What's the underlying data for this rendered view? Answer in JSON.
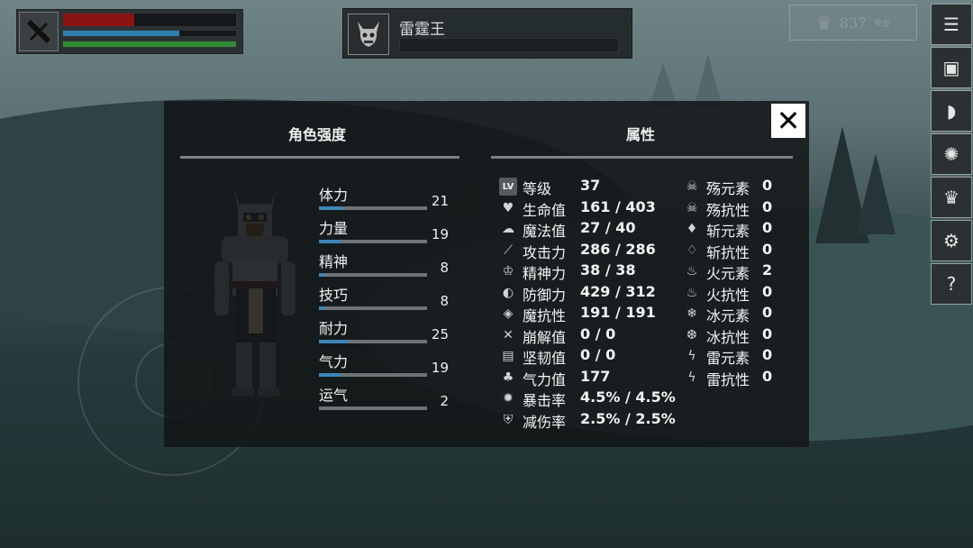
{
  "player": {
    "icon": "sword-icon",
    "health_fraction": 0.41,
    "mana_fraction": 0.67,
    "stamina_fraction": 1.0,
    "colors": {
      "health": "#8a1414",
      "mana": "#2f7fb0",
      "stamina": "#2f8a34"
    }
  },
  "boss": {
    "icon": "demon-skull-icon",
    "name": "雷霆王"
  },
  "honor": {
    "icon": "crown-icon",
    "value": "837",
    "unit": "荣誉"
  },
  "menu": [
    {
      "name": "list-menu-icon",
      "glyph": "☰"
    },
    {
      "name": "backpack-icon",
      "glyph": "▣"
    },
    {
      "name": "helmet-icon",
      "glyph": "◗"
    },
    {
      "name": "skill-medal-icon",
      "glyph": "✺"
    },
    {
      "name": "crown-menu-icon",
      "glyph": "♛"
    },
    {
      "name": "settings-gear-icon",
      "glyph": "⚙"
    },
    {
      "name": "help-question-icon",
      "glyph": "?"
    }
  ],
  "panel": {
    "left_title": "角色强度",
    "right_title": "属性",
    "close_label": "✕"
  },
  "stats": [
    {
      "label": "体力",
      "value": "21",
      "fill": 0.22
    },
    {
      "label": "力量",
      "value": "19",
      "fill": 0.2
    },
    {
      "label": "精神",
      "value": "8",
      "fill": 0.06
    },
    {
      "label": "技巧",
      "value": "8",
      "fill": 0.06
    },
    {
      "label": "耐力",
      "value": "25",
      "fill": 0.27
    },
    {
      "label": "气力",
      "value": "19",
      "fill": 0.2
    },
    {
      "label": "运气",
      "value": "2",
      "fill": 0.02
    }
  ],
  "attrs_left": [
    {
      "icon": "level-badge-icon",
      "glyph": "LV",
      "label": "等级",
      "value": "37"
    },
    {
      "icon": "heart-icon",
      "glyph": "♥",
      "label": "生命值",
      "value": "161 / 403"
    },
    {
      "icon": "brain-icon",
      "glyph": "☁",
      "label": "魔法值",
      "value": "27 / 40"
    },
    {
      "icon": "sword-attack-icon",
      "glyph": "⟋",
      "label": "攻击力",
      "value": "286 / 286"
    },
    {
      "icon": "spirit-crown-icon",
      "glyph": "♔",
      "label": "精神力",
      "value": "38 / 38"
    },
    {
      "icon": "shield-icon",
      "glyph": "◐",
      "label": "防御力",
      "value": "429 / 312"
    },
    {
      "icon": "magic-shield-icon",
      "glyph": "◈",
      "label": "魔抗性",
      "value": "191 / 191"
    },
    {
      "icon": "break-sword-icon",
      "glyph": "✕",
      "label": "崩解值",
      "value": "0 / 0"
    },
    {
      "icon": "armor-icon",
      "glyph": "▤",
      "label": "坚韧值",
      "value": "0 / 0"
    },
    {
      "icon": "lungs-icon",
      "glyph": "♣",
      "label": "气力值",
      "value": "177"
    },
    {
      "icon": "crit-burst-icon",
      "glyph": "✹",
      "label": "暴击率",
      "value": "4.5% / 4.5%"
    },
    {
      "icon": "damage-reduce-shield-icon",
      "glyph": "⛨",
      "label": "减伤率",
      "value": "2.5% / 2.5%"
    }
  ],
  "attrs_right": [
    {
      "icon": "skull-icon",
      "glyph": "☠",
      "label": "殇元素",
      "value": "0"
    },
    {
      "icon": "skull-resist-icon",
      "glyph": "☠",
      "label": "殇抗性",
      "value": "0"
    },
    {
      "icon": "drop-icon",
      "glyph": "♦",
      "label": "斩元素",
      "value": "0"
    },
    {
      "icon": "drop-resist-icon",
      "glyph": "♢",
      "label": "斩抗性",
      "value": "0"
    },
    {
      "icon": "fire-icon",
      "glyph": "♨",
      "label": "火元素",
      "value": "2"
    },
    {
      "icon": "fire-resist-icon",
      "glyph": "♨",
      "label": "火抗性",
      "value": "0"
    },
    {
      "icon": "snowflake-icon",
      "glyph": "❄",
      "label": "冰元素",
      "value": "0"
    },
    {
      "icon": "snowflake-resist-icon",
      "glyph": "❆",
      "label": "冰抗性",
      "value": "0"
    },
    {
      "icon": "lightning-icon",
      "glyph": "ϟ",
      "label": "雷元素",
      "value": "0"
    },
    {
      "icon": "lightning-resist-icon",
      "glyph": "ϟ",
      "label": "雷抗性",
      "value": "0"
    }
  ]
}
